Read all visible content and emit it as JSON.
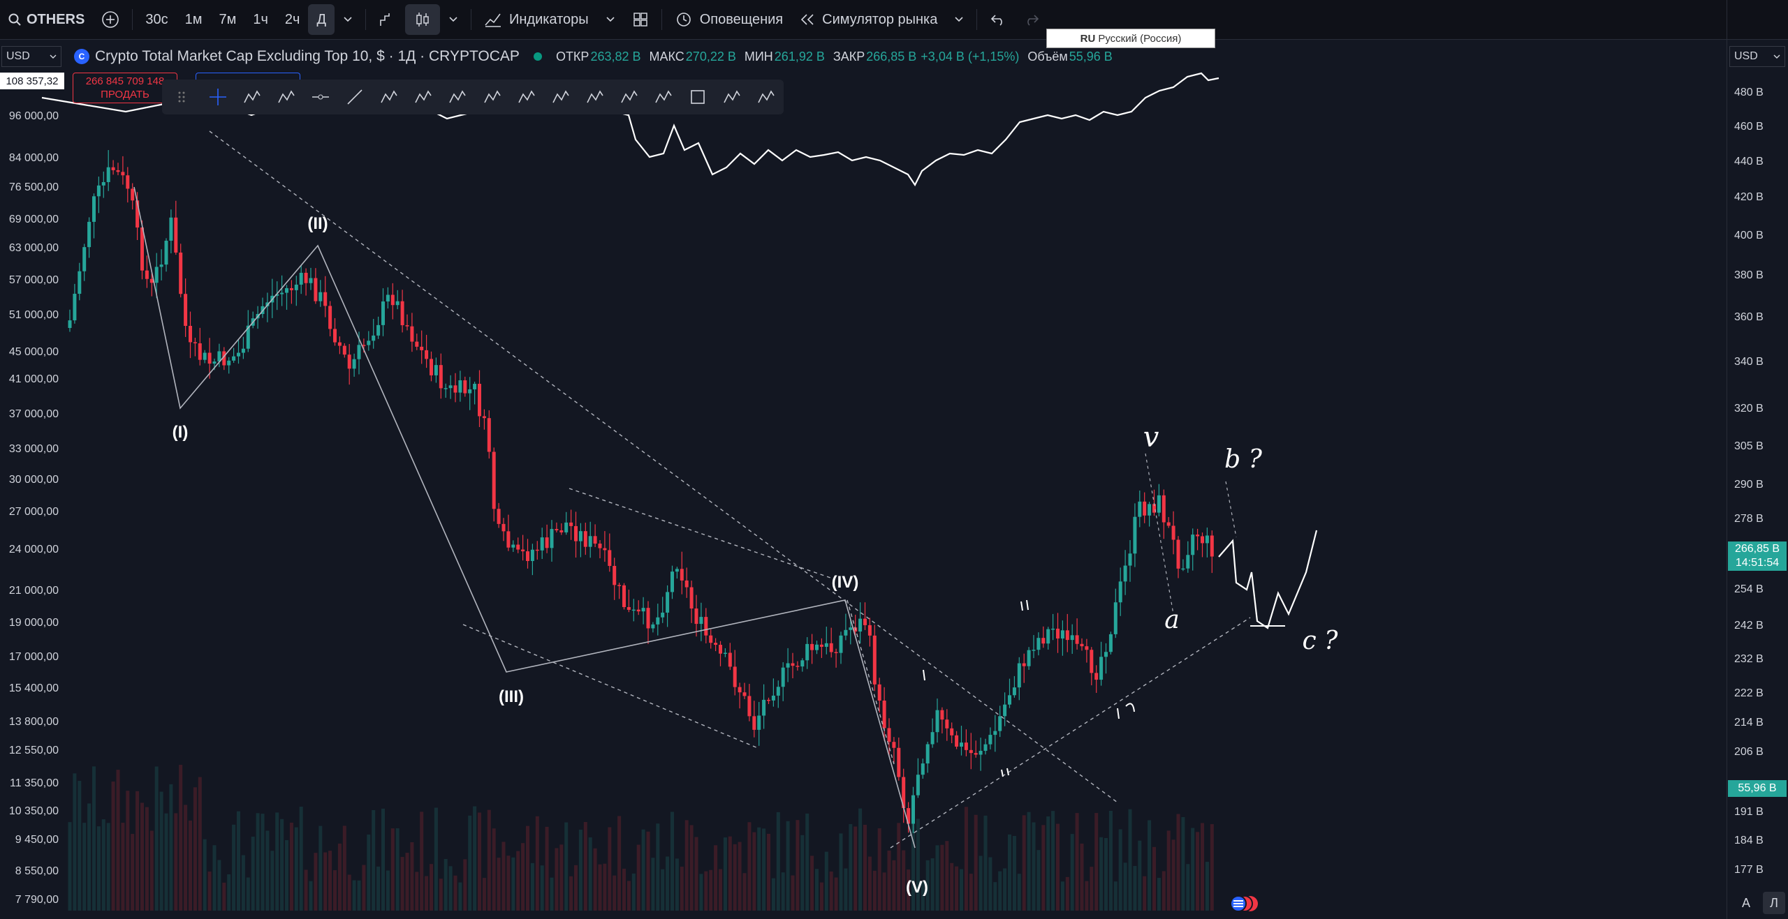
{
  "topbar": {
    "symbol": "OTHERS",
    "intervals": [
      "30с",
      "1м",
      "7м",
      "1ч",
      "2ч",
      "Д"
    ],
    "active_interval": "Д",
    "indicators_label": "Индикаторы",
    "alerts_label": "Оповещения",
    "replay_label": "Симулятор рынка"
  },
  "language_popup": {
    "code": "RU",
    "label": "Русский (Россия)"
  },
  "legend": {
    "currency": "USD",
    "title": "Crypto Total Market Cap Excluding Top 10, $ · 1Д · CRYPTOCAP",
    "open_label": "ОТКР",
    "open_value": "263,82 B",
    "high_label": "МАКС",
    "high_value": "270,22 B",
    "low_label": "МИН",
    "low_value": "261,92 B",
    "close_label": "ЗАКР",
    "close_value": "266,85 B",
    "change": "+3,04 B (+1,15%)",
    "volume_label": "Объём",
    "volume_value": "55,96 B"
  },
  "left_overlay_price": "108 357,32",
  "sell_button": {
    "price": "266 845 709 148",
    "label": "ПРОДАТЬ"
  },
  "right_currency": "USD",
  "left_axis": [
    "96 000,00",
    "84 000,00",
    "76 500,00",
    "69 000,00",
    "63 000,00",
    "57 000,00",
    "51 000,00",
    "45 000,00",
    "41 000,00",
    "37 000,00",
    "33 000,00",
    "30 000,00",
    "27 000,00",
    "24 000,00",
    "21 000,00",
    "19 000,00",
    "17 000,00",
    "15 400,00",
    "13 800,00",
    "12 550,00",
    "11 350,00",
    "10 350,00",
    "9 450,00",
    "8 550,00",
    "7 790,00"
  ],
  "right_axis": [
    "480 B",
    "460 B",
    "440 B",
    "420 B",
    "400 B",
    "380 B",
    "360 B",
    "340 B",
    "320 B",
    "305 B",
    "290 B",
    "278 B",
    "254 B",
    "242 B",
    "232 B",
    "222 B",
    "214 B",
    "206 B",
    "191 B",
    "184 B",
    "177 B"
  ],
  "last_price": {
    "value": "266,85 B",
    "countdown": "14:51:54"
  },
  "last_volume": "55,96 B",
  "wave_labels": [
    "(I)",
    "(II)",
    "(III)",
    "(IV)",
    "(V)"
  ],
  "handwritten_labels": [
    "v",
    "b ?",
    "a",
    "c ?"
  ],
  "bottom_buttons": [
    "A",
    "Л"
  ],
  "colors": {
    "up": "#26a69a",
    "down": "#f23645",
    "bg": "#131722",
    "accent": "#2962ff"
  },
  "icons": [
    "search-icon",
    "add-icon",
    "bar-style-icon",
    "candles-icon",
    "indicators-icon",
    "layouts-icon",
    "alert-icon",
    "replay-icon",
    "undo-icon",
    "redo-icon"
  ]
}
